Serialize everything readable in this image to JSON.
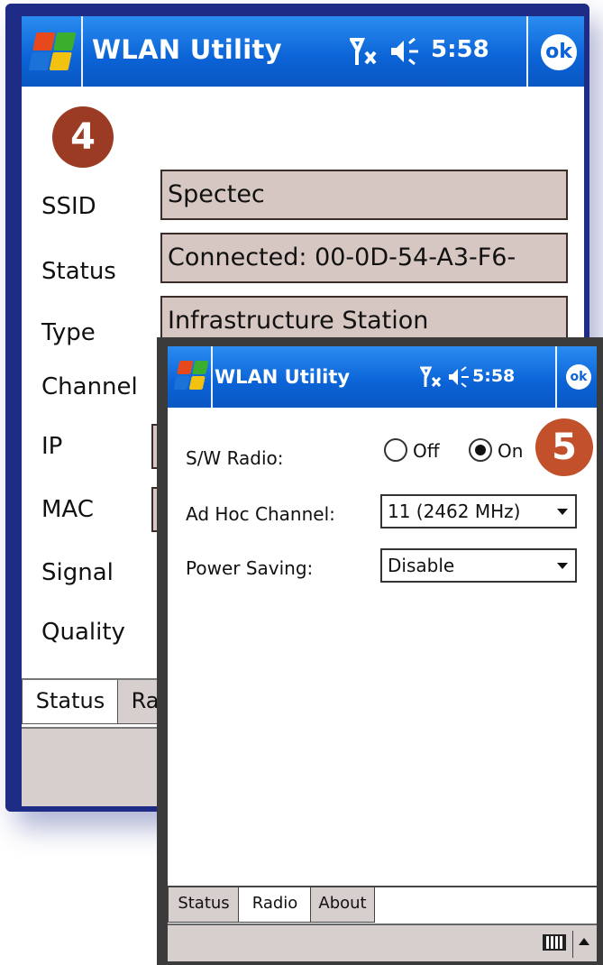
{
  "back_window": {
    "app_title": "WLAN Utility",
    "clock": "5:58",
    "ok_label": "ok",
    "step_badge": "4",
    "fields": {
      "ssid_label": "SSID",
      "ssid_value": "Spectec",
      "status_label": "Status",
      "status_value": "Connected: 00-0D-54-A3-F6-",
      "type_label": "Type",
      "type_value": "Infrastructure Station",
      "channel_label": "Channel",
      "ip_label": "IP",
      "mac_label": "MAC",
      "signal_label": "Signal",
      "quality_label": "Quality"
    },
    "tabs": [
      "Status",
      "Ra"
    ]
  },
  "front_window": {
    "app_title": "WLAN Utility",
    "clock": "5:58",
    "ok_label": "ok",
    "step_badge": "5",
    "sw_radio_label": "S/W Radio:",
    "radio_off_label": "Off",
    "radio_on_label": "On",
    "radio_selected": "On",
    "adhoc_label": "Ad Hoc Channel:",
    "adhoc_value": "11 (2462 MHz)",
    "power_label": "Power Saving:",
    "power_value": "Disable",
    "tabs": [
      "Status",
      "Radio",
      "About"
    ],
    "active_tab": "Radio"
  },
  "colors": {
    "device_frame": "#1e2c86",
    "titlebar": "#0b63d6",
    "field_bg": "#d7c7c2",
    "badge_4": "#9b3b24",
    "badge_5": "#c1502b"
  }
}
